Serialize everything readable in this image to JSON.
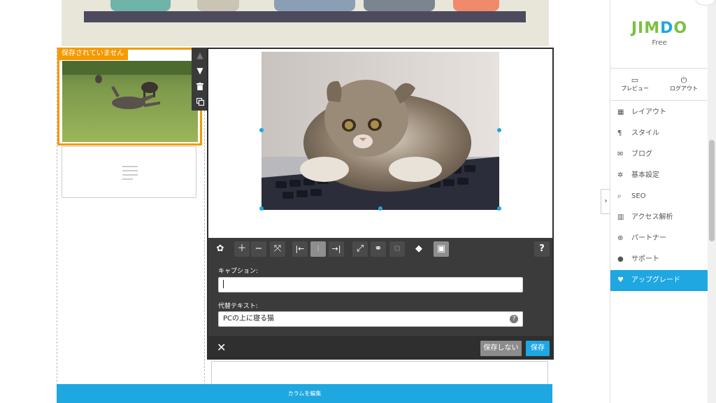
{
  "left_column": {
    "unsaved_badge": "保存されていません"
  },
  "float_controls": {
    "up_icon": "chevron-up-icon",
    "down_icon": "chevron-down-icon",
    "delete_icon": "trash-icon",
    "copy_icon": "copy-icon"
  },
  "editor": {
    "toolbar_icons": [
      "flickr-icon",
      "zoom-in-icon",
      "zoom-out-icon",
      "fit-icon",
      "align-left-icon",
      "align-center-icon",
      "align-right-icon",
      "enlarge-icon",
      "link-icon",
      "crop-icon",
      "tag-icon",
      "caption-toggle-icon",
      "help-icon"
    ],
    "help_label": "?",
    "caption_label": "キャプション:",
    "caption_value": "",
    "alt_label": "代替テキスト:",
    "alt_value": "PCの上に寝る猫",
    "field_help": "?",
    "close_label": "✕",
    "nosave_label": "保存しない",
    "save_label": "保存"
  },
  "edit_columns_label": "カラムを編集",
  "sidebar": {
    "logo_parts": [
      "JIM",
      "D",
      "O"
    ],
    "plan": "Free",
    "preview_label": "プレビュー",
    "logout_label": "ログアウト",
    "menu": [
      {
        "icon": "layout-icon",
        "label": "レイアウト"
      },
      {
        "icon": "style-icon",
        "label": "スタイル"
      },
      {
        "icon": "blog-icon",
        "label": "ブログ"
      },
      {
        "icon": "settings-icon",
        "label": "基本設定"
      },
      {
        "icon": "search-icon",
        "label": "SEO"
      },
      {
        "icon": "analytics-icon",
        "label": "アクセス解析"
      },
      {
        "icon": "partner-icon",
        "label": "パートナー"
      },
      {
        "icon": "support-icon",
        "label": "サポート"
      },
      {
        "icon": "heart-icon",
        "label": "アップグレード"
      }
    ],
    "active_index": 8
  },
  "colors": {
    "accent": "#1ea7e1",
    "warning": "#f59a00",
    "logo_green": "#7ac143"
  }
}
